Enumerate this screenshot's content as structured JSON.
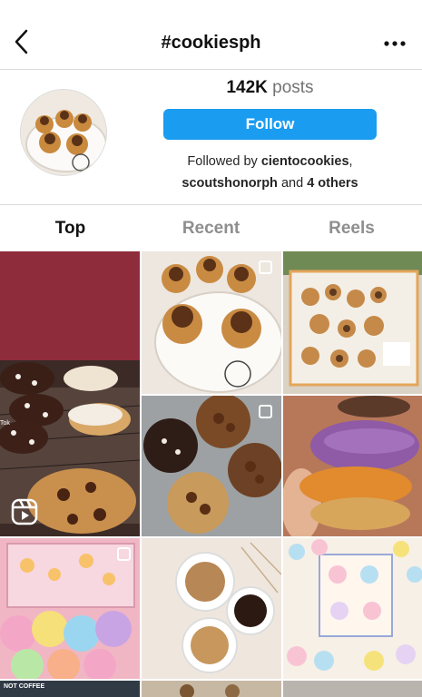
{
  "header": {
    "title": "#cookiesph",
    "back_icon": "chevron-left-icon",
    "more_icon": "more-horizontal-icon"
  },
  "profile": {
    "posts_count": "142K",
    "posts_label": "posts",
    "follow_label": "Follow",
    "followed_prefix": "Followed by",
    "followed_user1": "ciento",
    "followed_user1b": "cookies",
    "followed_sep": ",",
    "followed_user2": "scoutshonorph",
    "followed_and": "and",
    "followed_others": "4 others",
    "avatar_icon": "cookies-plate-avatar"
  },
  "tabs": [
    {
      "label": "Top",
      "active": true
    },
    {
      "label": "Recent",
      "active": false
    },
    {
      "label": "Reels",
      "active": false
    }
  ],
  "grid": {
    "tiktok_label": "Tok",
    "strip_label": "NOT COFFEE",
    "reel_icon": "reels-icon",
    "multi_icon": "multiple-posts-icon"
  },
  "colors": {
    "follow_blue": "#1a9cf0",
    "divider": "#dbdbdb",
    "muted_text": "#8e8e8e"
  }
}
